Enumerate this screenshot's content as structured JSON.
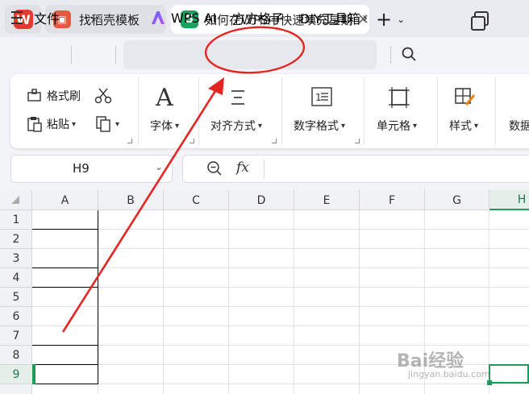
{
  "titlebar": {
    "app_logo": "W",
    "tabs": [
      {
        "label": "找稻壳模板"
      },
      {
        "label": "如何在WPS中快速填充星期"
      }
    ],
    "sheet_icon_letter": "S",
    "close_glyph": "✕",
    "new_tab_glyph": "+",
    "chevron_glyph": "⌄"
  },
  "menubar": {
    "file_label": "文件",
    "more_glyph": "···",
    "prev_glyph": "‹",
    "next_glyph": "›",
    "items": [
      "WPS AI",
      "方方格子",
      "DIY工具箱"
    ]
  },
  "ribbon": {
    "format_painter": "格式刷",
    "paste": "粘贴",
    "font": "字体",
    "align": "对齐方式",
    "number_format": "数字格式",
    "cell": "单元格",
    "style": "样式",
    "data": "数据"
  },
  "formula_bar": {
    "name_box": "H9",
    "fx_label": "fx",
    "formula_value": ""
  },
  "grid": {
    "columns": [
      "A",
      "B",
      "C",
      "D",
      "E",
      "F",
      "G",
      "H"
    ],
    "rows": [
      "1",
      "2",
      "3",
      "4",
      "5",
      "6",
      "7",
      "8",
      "9"
    ],
    "selected_cell": "H9",
    "accent_color": "#1f9b5c"
  },
  "annotation": {
    "color": "#e52521"
  },
  "watermark": {
    "text": "Bai经验",
    "sub": "jingyan.baidu.com"
  }
}
